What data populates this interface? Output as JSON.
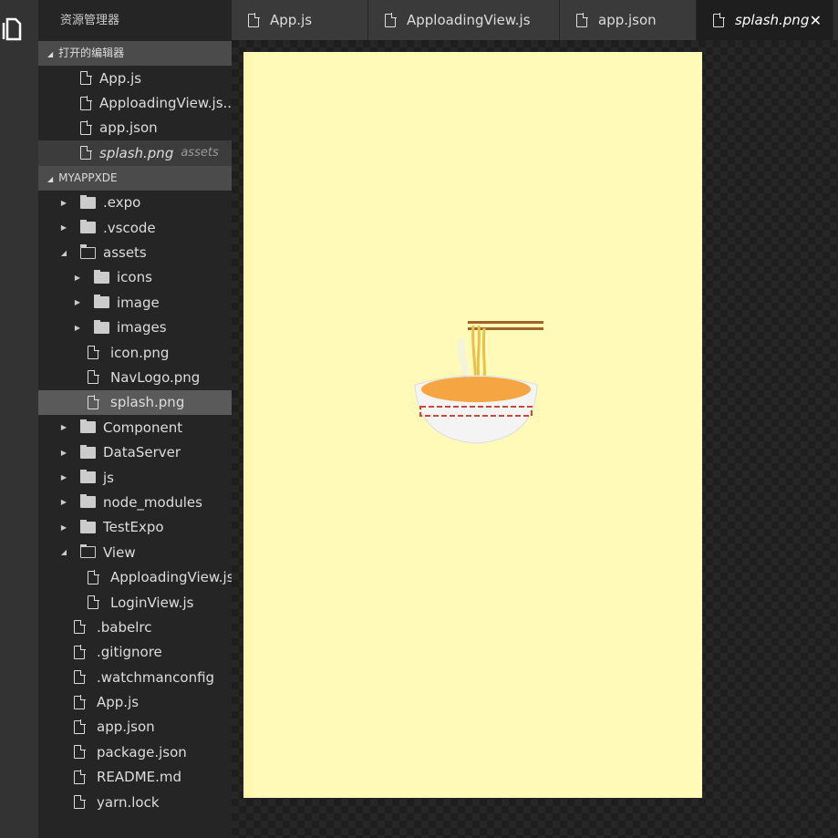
{
  "sidebar": {
    "title": "资源管理器",
    "open_editors": {
      "header": "打开的编辑器",
      "items": [
        {
          "label": "App.js"
        },
        {
          "label": "ApploadingView.js..."
        },
        {
          "label": "app.json"
        },
        {
          "label": "splash.png",
          "desc": "assets"
        }
      ]
    },
    "project": {
      "header": "MYAPPXDE",
      "items": [
        {
          "label": ".expo",
          "type": "folder",
          "level": 0,
          "open": false
        },
        {
          "label": ".vscode",
          "type": "folder",
          "level": 0,
          "open": false
        },
        {
          "label": "assets",
          "type": "folder",
          "level": 0,
          "open": true
        },
        {
          "label": "icons",
          "type": "folder",
          "level": 1,
          "open": false
        },
        {
          "label": "image",
          "type": "folder",
          "level": 1,
          "open": false
        },
        {
          "label": "images",
          "type": "folder",
          "level": 1,
          "open": false
        },
        {
          "label": "icon.png",
          "type": "file",
          "level": 1
        },
        {
          "label": "NavLogo.png",
          "type": "file",
          "level": 1
        },
        {
          "label": "splash.png",
          "type": "file",
          "level": 1,
          "selected": true
        },
        {
          "label": "Component",
          "type": "folder",
          "level": 0,
          "open": false
        },
        {
          "label": "DataServer",
          "type": "folder",
          "level": 0,
          "open": false
        },
        {
          "label": "js",
          "type": "folder",
          "level": 0,
          "open": false
        },
        {
          "label": "node_modules",
          "type": "folder",
          "level": 0,
          "open": false
        },
        {
          "label": "TestExpo",
          "type": "folder",
          "level": 0,
          "open": false
        },
        {
          "label": "View",
          "type": "folder",
          "level": 0,
          "open": true
        },
        {
          "label": "ApploadingView.js",
          "type": "file",
          "level": 1
        },
        {
          "label": "LoginView.js",
          "type": "file",
          "level": 1
        },
        {
          "label": ".babelrc",
          "type": "file",
          "level": 0
        },
        {
          "label": ".gitignore",
          "type": "file",
          "level": 0
        },
        {
          "label": ".watchmanconfig",
          "type": "file",
          "level": 0
        },
        {
          "label": "App.js",
          "type": "file",
          "level": 0
        },
        {
          "label": "app.json",
          "type": "file",
          "level": 0
        },
        {
          "label": "package.json",
          "type": "file",
          "level": 0
        },
        {
          "label": "README.md",
          "type": "file",
          "level": 0
        },
        {
          "label": "yarn.lock",
          "type": "file",
          "level": 0
        }
      ]
    }
  },
  "tabs": [
    {
      "label": "App.js"
    },
    {
      "label": "ApploadingView.js"
    },
    {
      "label": "app.json"
    },
    {
      "label": "splash.png",
      "active": true
    }
  ],
  "tab_close": "✕",
  "colors": {
    "splash_bg": "#fffab8"
  }
}
